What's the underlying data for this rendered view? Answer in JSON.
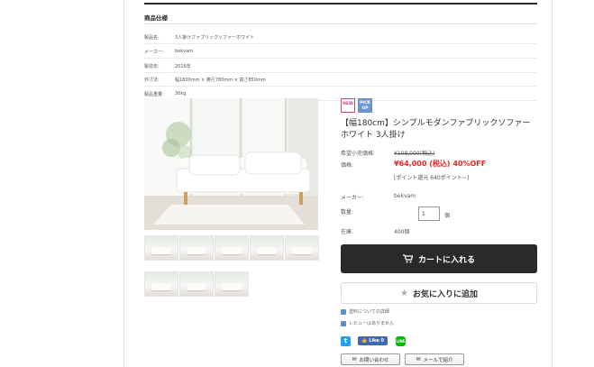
{
  "spec": {
    "title": "商品仕様",
    "rows": [
      {
        "key": "製品名:",
        "value": "3人掛けファブリックソファーホワイト"
      },
      {
        "key": "メーカー:",
        "value": "bekvam"
      },
      {
        "key": "製造年:",
        "value": "2016年"
      },
      {
        "key": "外寸法:",
        "value": "幅1800mm × 奥行780mm × 高さ850mm"
      },
      {
        "key": "製品重量:",
        "value": "30kg"
      }
    ]
  },
  "badges": {
    "new": "NEW",
    "pick_up": "PICK UP"
  },
  "product": {
    "title": "【幅180cm】シンプルモダンファブリックソファー ホワイト 3人掛け",
    "list_price_label": "希望小売価格:",
    "list_price": "¥108,000(税込)",
    "price_label": "価格:",
    "price": "¥64,000 (税込) 40%OFF",
    "points": "[ポイント還元 640ポイント~]",
    "maker_label": "メーカー:",
    "maker": "bekvam",
    "qty_label": "数量:",
    "qty_value": "1",
    "qty_unit": "個",
    "stock_label": "在庫:",
    "stock": "400個"
  },
  "buttons": {
    "cart": "カートに入れる",
    "favorite": "お気に入りに追加",
    "contact": "お問い合わせ",
    "mail": "メールで紹介"
  },
  "links": {
    "shipping": "送料についての詳細",
    "review": "レビューはありません"
  },
  "social": {
    "twitter": "t",
    "facebook": "Like 0",
    "line": "LINE"
  },
  "colors": {
    "accent_price": "#e8262a",
    "cart_bg": "#2a2a2a",
    "new_badge": "#d9437a",
    "pickup_badge": "#6f95cf"
  }
}
